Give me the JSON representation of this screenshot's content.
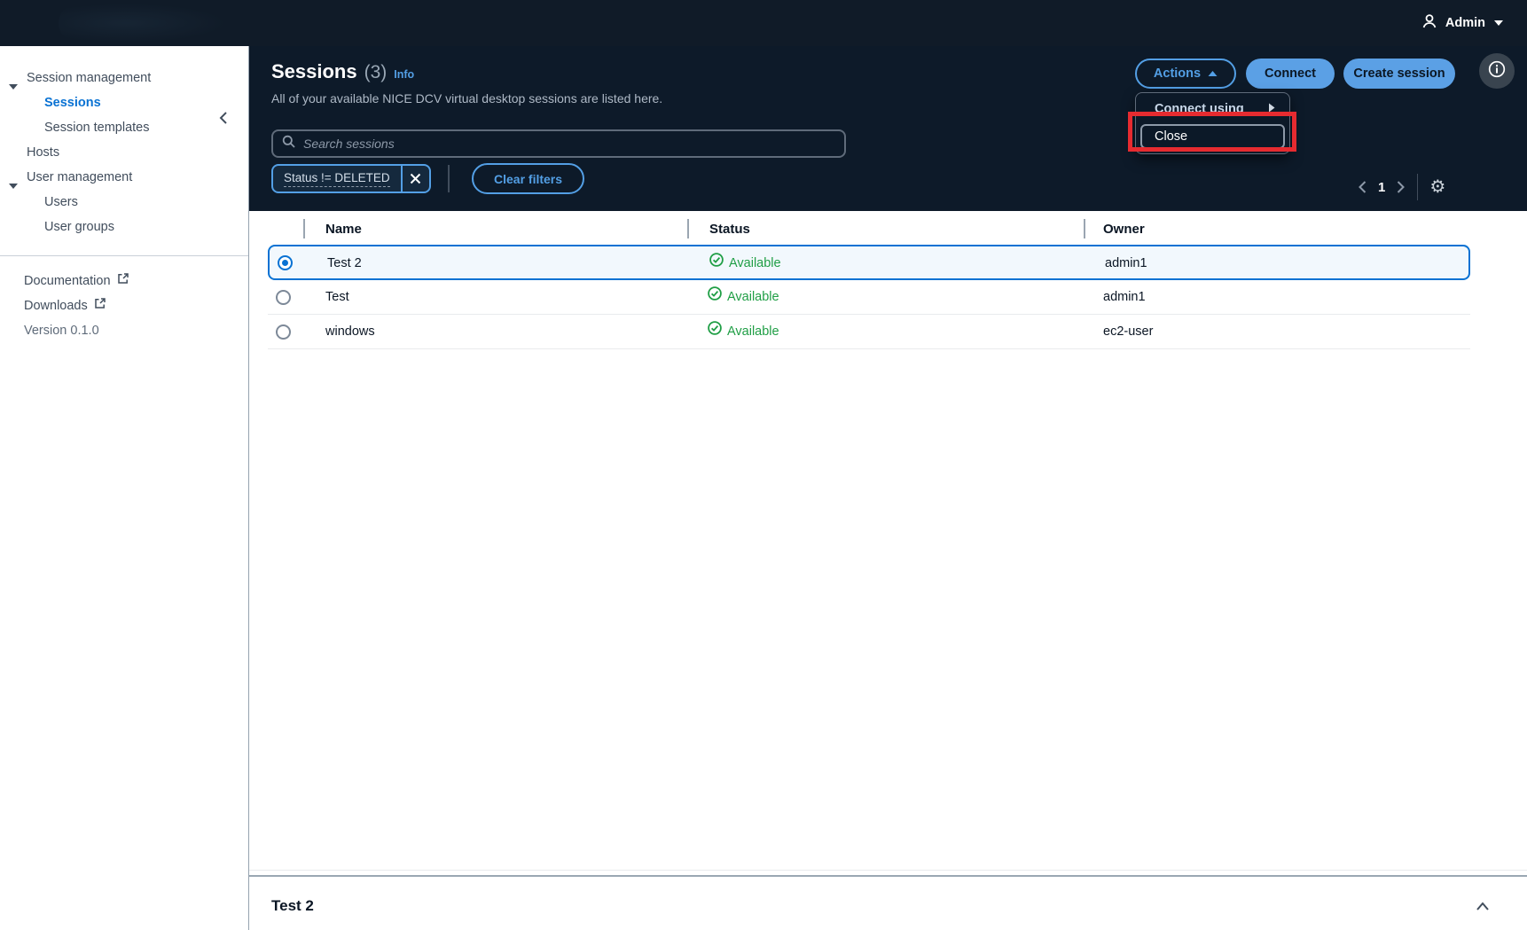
{
  "topbar": {
    "user_label": "Admin"
  },
  "sidebar": {
    "items": [
      {
        "label": "Session management"
      },
      {
        "label": "Sessions"
      },
      {
        "label": "Session templates"
      },
      {
        "label": "Hosts"
      },
      {
        "label": "User management"
      },
      {
        "label": "Users"
      },
      {
        "label": "User groups"
      }
    ],
    "footer": {
      "documentation": "Documentation",
      "downloads": "Downloads",
      "version": "Version 0.1.0"
    }
  },
  "header": {
    "title": "Sessions",
    "count": "(3)",
    "info_label": "Info",
    "description": "All of your available NICE DCV virtual desktop sessions are listed here.",
    "search_placeholder": "Search sessions",
    "filter_token": "Status != DELETED",
    "clear_filters_label": "Clear filters",
    "actions_label": "Actions",
    "connect_label": "Connect",
    "create_session_label": "Create session"
  },
  "dropdown": {
    "connect_using": "Connect using",
    "close": "Close"
  },
  "table": {
    "columns": [
      "Name",
      "Status",
      "Owner"
    ],
    "rows": [
      {
        "name": "Test 2",
        "status": "Available",
        "owner": "admin1"
      },
      {
        "name": "Test",
        "status": "Available",
        "owner": "admin1"
      },
      {
        "name": "windows",
        "status": "Available",
        "owner": "ec2-user"
      }
    ]
  },
  "pagination": {
    "page": "1"
  },
  "split_panel": {
    "title": "Test 2"
  },
  "colors": {
    "topbar_bg": "#101b28",
    "band_bg": "#0d1a29",
    "accent_blue": "#539fe5",
    "primary_button_bg": "#5ba0e5",
    "selected_row_border": "#0972d3",
    "selected_row_bg": "#f2f8fd",
    "success_green": "#1f9e45",
    "annotation_red": "#e62b30",
    "sidebar_active_link": "#0972d3"
  }
}
